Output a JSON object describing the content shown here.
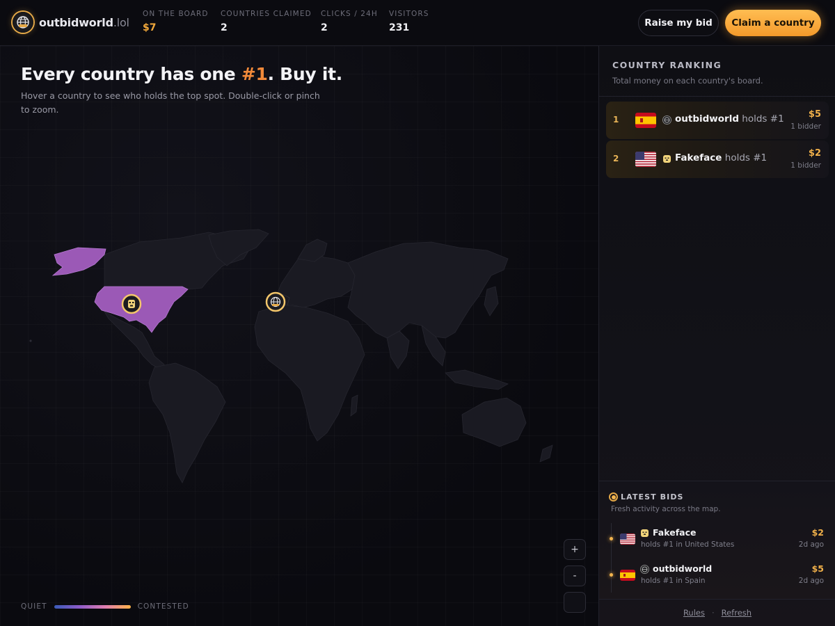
{
  "brand": {
    "name": "outbidworld",
    "tld": ".lol",
    "logo_icon": "globe-icon"
  },
  "stats": [
    {
      "label": "ON THE BOARD",
      "value": "$7"
    },
    {
      "label": "COUNTRIES CLAIMED",
      "value": "2"
    },
    {
      "label": "CLICKS / 24H",
      "value": "2"
    },
    {
      "label": "VISITORS",
      "value": "231"
    }
  ],
  "header_actions": {
    "raise_label": "Raise my bid",
    "claim_label": "Claim a country"
  },
  "hero": {
    "title_pre": "Every country has one ",
    "title_highlight": "#1",
    "title_post": ". Buy it.",
    "subtitle": "Hover a country to see who holds the top spot. Double-click or pinch to zoom."
  },
  "map": {
    "claimed_color": "#9b59b6",
    "land_color": "#1a1a22",
    "markers": [
      {
        "country": "United States",
        "avatar": "mask-icon"
      },
      {
        "country": "Spain",
        "avatar": "globe-icon"
      }
    ]
  },
  "legend": {
    "low": "QUIET",
    "high": "CONTESTED"
  },
  "zoom": {
    "in": "+",
    "out": "-"
  },
  "ranking": {
    "title": "COUNTRY RANKING",
    "subtitle": "Total money on each country's board.",
    "rows": [
      {
        "rank": "1",
        "flag": "spain-flag",
        "name": "outbidworld",
        "holds": " holds #1",
        "amount": "$5",
        "bidders": "1 bidder",
        "avatar": "globe-icon"
      },
      {
        "rank": "2",
        "flag": "us-flag",
        "name": "Fakeface",
        "holds": " holds #1",
        "amount": "$2",
        "bidders": "1 bidder",
        "avatar": "mask-icon"
      }
    ]
  },
  "latest": {
    "title": "LATEST BIDS",
    "subtitle": "Fresh activity across the map.",
    "items": [
      {
        "flag": "us-flag",
        "name": "Fakeface",
        "desc": "holds #1 in United States",
        "amount": "$2",
        "time": "2d ago",
        "avatar": "mask-icon"
      },
      {
        "flag": "spain-flag",
        "name": "outbidworld",
        "desc": "holds #1 in Spain",
        "amount": "$5",
        "time": "2d ago",
        "avatar": "globe-icon"
      }
    ]
  },
  "footer": {
    "rules": "Rules",
    "sep": "·",
    "refresh": "Refresh"
  },
  "colors": {
    "accent": "#f2a93b",
    "highlight": "#f28a3a"
  }
}
